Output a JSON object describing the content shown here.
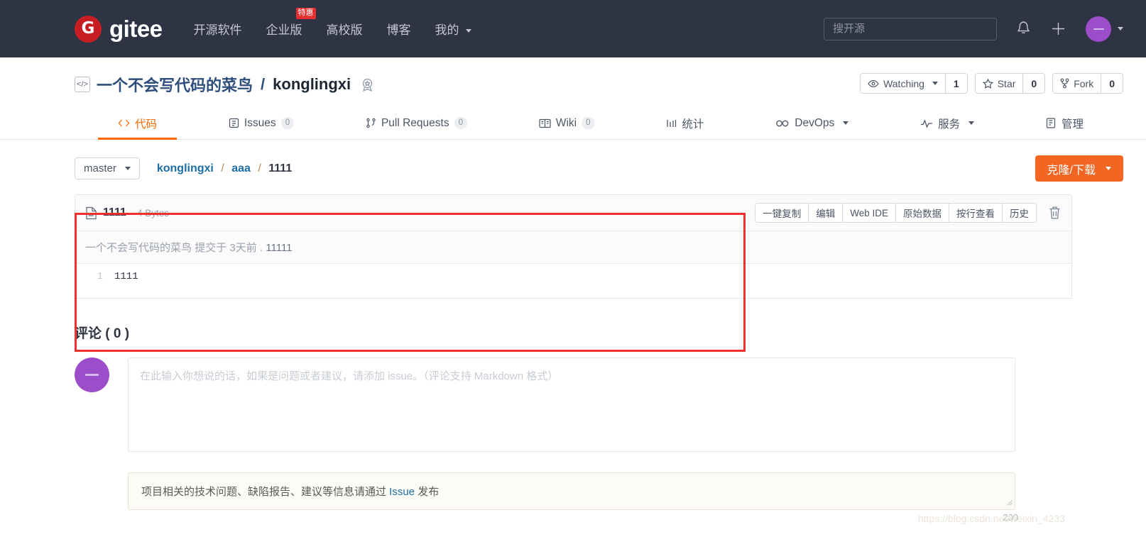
{
  "topnav": {
    "logo_text": "gitee",
    "logo_mark": "G",
    "items": [
      {
        "label": "开源软件",
        "badge": null,
        "caret": false
      },
      {
        "label": "企业版",
        "badge": "特惠",
        "caret": false
      },
      {
        "label": "高校版",
        "badge": null,
        "caret": false
      },
      {
        "label": "博客",
        "badge": null,
        "caret": false
      },
      {
        "label": "我的",
        "badge": null,
        "caret": true
      }
    ],
    "search_placeholder": "搜开源",
    "search_value": "",
    "bell_icon": "bell-icon",
    "plus_icon": "plus-icon",
    "avatar_icon": "user-avatar"
  },
  "repo": {
    "owner": "一个不会写代码的菜鸟",
    "separator": "/",
    "name": "konglingxi",
    "code_icon_glyph": "</>",
    "medal_icon": "medal-icon",
    "actions": {
      "watch_label": "Watching",
      "watch_count": "1",
      "star_label": "Star",
      "star_count": "0",
      "fork_label": "Fork",
      "fork_count": "0"
    }
  },
  "tabs": [
    {
      "label": "代码",
      "count": null,
      "active": true,
      "icon": "code-icon",
      "caret": false
    },
    {
      "label": "Issues",
      "count": "0",
      "active": false,
      "icon": "issue-icon",
      "caret": false
    },
    {
      "label": "Pull Requests",
      "count": "0",
      "active": false,
      "icon": "pr-icon",
      "caret": false
    },
    {
      "label": "Wiki",
      "count": "0",
      "active": false,
      "icon": "wiki-icon",
      "caret": false
    },
    {
      "label": "统计",
      "count": null,
      "active": false,
      "icon": "chart-icon",
      "caret": false
    },
    {
      "label": "DevOps",
      "count": null,
      "active": false,
      "icon": "infinity-icon",
      "caret": true
    },
    {
      "label": "服务",
      "count": null,
      "active": false,
      "icon": "pulse-icon",
      "caret": true
    },
    {
      "label": "管理",
      "count": null,
      "active": false,
      "icon": "settings-icon",
      "caret": false
    }
  ],
  "controls": {
    "branch": "master",
    "breadcrumb": [
      {
        "label": "konglingxi",
        "link": true
      },
      {
        "label": "aaa",
        "link": true
      },
      {
        "label": "1111",
        "link": false
      }
    ],
    "breadcrumb_sep": "/",
    "clone_label": "克隆/下载"
  },
  "file": {
    "name": "1111",
    "size": "4 Bytes",
    "file_icon": "file-icon",
    "tools": [
      "一键复制",
      "编辑",
      "Web IDE",
      "原始数据",
      "按行查看",
      "历史"
    ],
    "trash_icon": "trash-icon",
    "commit_author": "一个不会写代码的菜鸟",
    "commit_verb": "提交于",
    "commit_time": "3天前",
    "commit_dot": ".",
    "commit_message": "11111",
    "lines": [
      {
        "num": "1",
        "code": "1111"
      }
    ]
  },
  "comments": {
    "heading": "评论 ( 0 )",
    "avatar_icon": "user-avatar",
    "textarea_placeholder": "在此输入你想说的话，如果是问题或者建议，请添加 issue。（评论支持 Markdown 格式）",
    "textarea_value": "",
    "counter": "200",
    "notice_prefix": "项目相关的技术问题、缺陷报告、建议等信息请通过 ",
    "notice_link": "Issue",
    "notice_suffix": " 发布"
  },
  "watermark": "https://blog.csdn.net/weixin_4233",
  "colors": {
    "nav_bg": "#2f3445",
    "brand_red": "#c71d23",
    "accent_orange": "#ff6a00",
    "clone_orange": "#f26522",
    "link_blue": "#1c6ea4",
    "annotation_red": "#f0302c",
    "avatar_purple": "#9b4dca"
  }
}
